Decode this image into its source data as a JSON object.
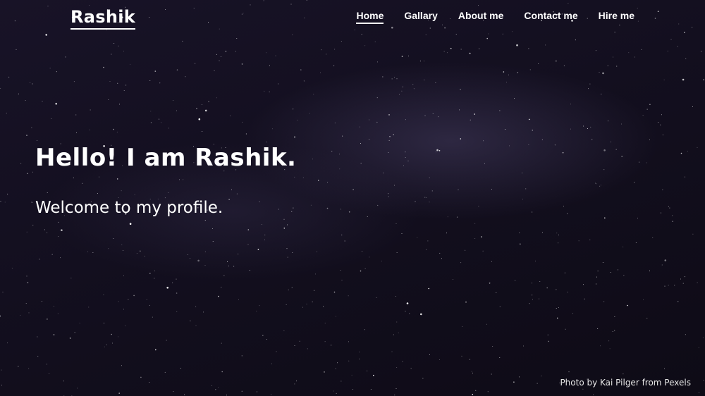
{
  "brand": {
    "name": "Rashik"
  },
  "nav": {
    "items": [
      {
        "label": "Home",
        "active": true
      },
      {
        "label": "Gallary",
        "active": false
      },
      {
        "label": "About me",
        "active": false
      },
      {
        "label": "Contact me",
        "active": false
      },
      {
        "label": "Hire me",
        "active": false
      }
    ]
  },
  "hero": {
    "headline": "Hello! I am Rashik.",
    "subheadline": "Welcome to my profile."
  },
  "footer": {
    "photo_credit": "Photo by Kai Pilger from Pexels"
  },
  "colors": {
    "background": "#100d19",
    "text": "#ffffff"
  }
}
